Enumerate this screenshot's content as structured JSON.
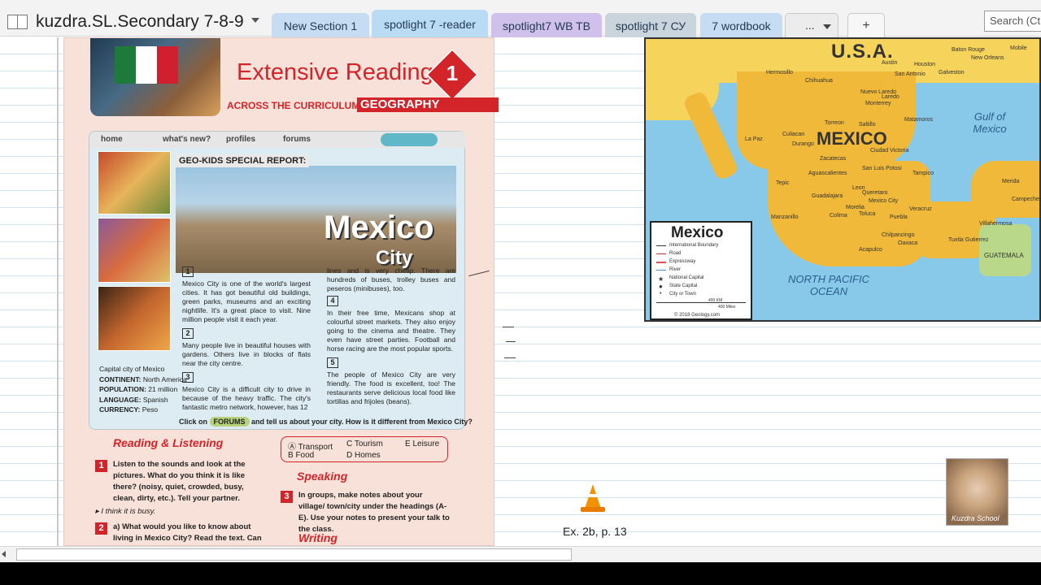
{
  "notebook": {
    "title": "kuzdra.SL.Secondary 7-8-9"
  },
  "tabs": [
    {
      "label": "New Section 1",
      "color": "#c6dcf2"
    },
    {
      "label": "spotlight 7 -reader",
      "color": "#b9dbf4"
    },
    {
      "label": "spotlight7 WB TB",
      "color": "#cfc0ec"
    },
    {
      "label": "spotlight 7 СУ",
      "color": "#c9d4dd"
    },
    {
      "label": "7 wordbook",
      "color": "#c6dcf2"
    }
  ],
  "more_tabs_label": "...",
  "add_tab_label": "+",
  "search": {
    "placeholder": "Search (Ctrl+E)"
  },
  "page": {
    "book": {
      "banner_title": "Extensive Reading",
      "unit_number": "1",
      "across": "ACROSS THE CURRICULUM:",
      "subject": "GEOGRAPHY",
      "site_nav": [
        "home",
        "what's new?",
        "profiles",
        "forums"
      ],
      "report_label": "GEO-KIDS SPECIAL REPORT:",
      "photo_title": "Mexico",
      "photo_subtitle": "City",
      "capital_info": [
        {
          "label": "",
          "value": "Capital city of Mexico"
        },
        {
          "label": "CONTINENT:",
          "value": " North America"
        },
        {
          "label": "POPULATION:",
          "value": " 21 million"
        },
        {
          "label": "LANGUAGE:",
          "value": " Spanish"
        },
        {
          "label": "CURRENCY:",
          "value": " Peso"
        }
      ],
      "paragraphs": [
        {
          "num": "1",
          "text": "Mexico City is one of the world's largest cities. It has got beautiful old buildings, green parks, museums and an exciting nightlife. It's a great place to visit. Nine million people visit it each year."
        },
        {
          "num": "2",
          "text": "Many people live in beautiful houses with gardens. Others live in blocks of flats near the city centre."
        },
        {
          "num": "3",
          "text": "Mexico City is a difficult city to drive in because of the heavy traffic. The city's fantastic metro network, however, has 12"
        },
        {
          "num": "",
          "text": "lines and is very cheap. There are hundreds of buses, trolley buses and peseros (minibuses), too."
        },
        {
          "num": "4",
          "text": "In their free time, Mexicans shop at colourful street markets. They also enjoy going to the cinema and theatre. They even have street parties. Football and horse racing are the most popular sports."
        },
        {
          "num": "5",
          "text": "The people of Mexico City are very friendly. The food is excellent, too! The restaurants serve delicious local food like tortillas and frijoles (beans)."
        }
      ],
      "click_prefix": "Click on ",
      "forums_pill": "FORUMS",
      "click_suffix": " and tell us about your city. How is it different from Mexico City?",
      "reading_head": "Reading & Listening",
      "speaking_head": "Speaking",
      "writing_head": "Writing",
      "ex1_num": "1",
      "ex1_text": "Listen to the sounds and look at the pictures. What do you think it is like there? (noisy, quiet, crowded, busy, clean, dirty, etc.). Tell your partner.",
      "ex1_example": "▸ I think it is busy.",
      "ex2_num": "2",
      "ex2_text": "a) What would you like to know about living in Mexico City? Read the text. Can",
      "ex3_num": "3",
      "ex3_text": "In groups, make notes about your village/ town/city under the headings (A-E). Use your notes to present your talk to the class.",
      "options": [
        "Ⓐ Transport",
        "C  Tourism",
        "E  Leisure",
        "B  Food",
        "D  Homes"
      ]
    },
    "map": {
      "country": "MEXICO",
      "usa": "U.S.A.",
      "gulf": "Gulf of Mexico",
      "ocean": "NORTH PACIFIC OCEAN",
      "guatemala": "GUATEMALA",
      "legend_title": "Mexico",
      "legend_items": [
        "International Boundary",
        "Road",
        "Expressway",
        "River",
        "National Capital",
        "State Capital",
        "City or Town"
      ],
      "scale_km": "400 KM",
      "scale_mi": "400 Miles",
      "copyright": "© 2018 Geology.com",
      "cities": [
        "Hermosillo",
        "Chihuahua",
        "Monterrey",
        "Culiacan",
        "Durango",
        "Zacatecas",
        "San Luis Potosi",
        "Guadalajara",
        "Mexico City",
        "Puebla",
        "Veracruz",
        "Oaxaca",
        "Acapulco",
        "Merida",
        "Campeche",
        "Villahermosa",
        "Tampico",
        "Torreon",
        "Saltillo",
        "La Paz",
        "Morelia",
        "Toluca",
        "Aguascalientes",
        "Leon",
        "Queretaro",
        "Tuxtla Gutierrez",
        "Chilpancingo",
        "Colima",
        "Tepic",
        "Manzanillo",
        "Ciudad Victoria",
        "Matamoros",
        "Nuevo Laredo",
        "Laredo",
        "San Antonio",
        "Houston",
        "New Orleans",
        "Mobile",
        "Baton Rouge",
        "Austin",
        "Galveston"
      ]
    },
    "caption": "Ex. 2b, p. 13",
    "avatar_label": "Kuzdra School"
  }
}
